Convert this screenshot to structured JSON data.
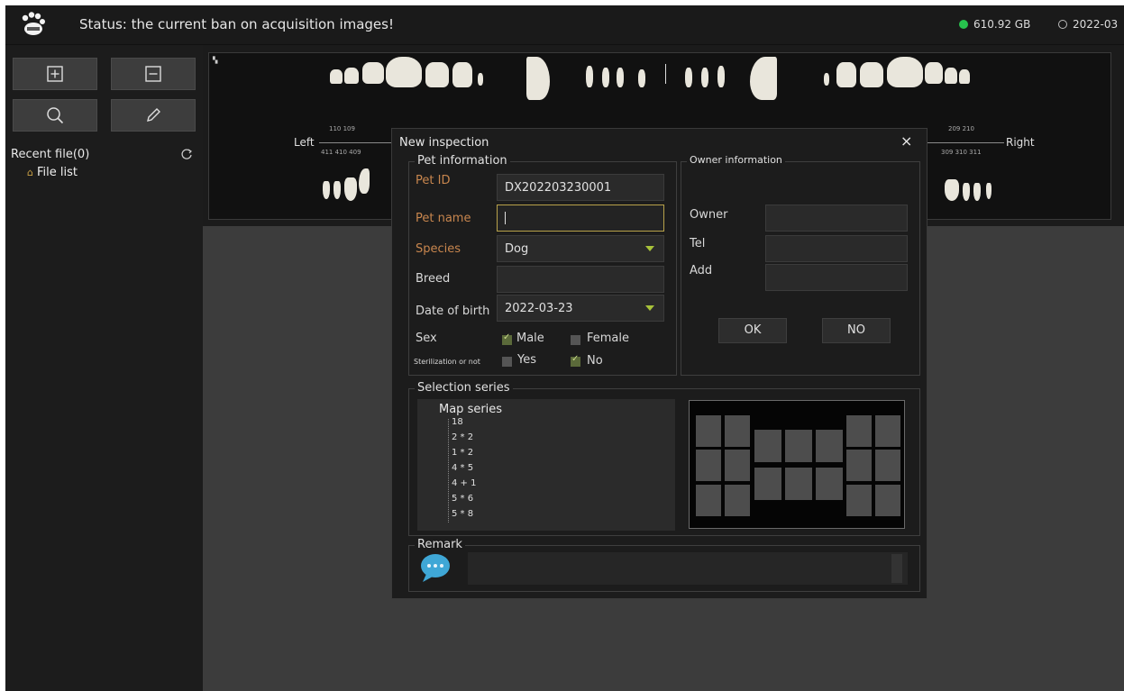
{
  "topbar": {
    "logo": "paw-logo",
    "status_text": "Status: the current ban on acquisition images!",
    "disk_free": "610.92 GB",
    "date": "2022-03",
    "disk_dot_color": "#27c34d"
  },
  "sidebar": {
    "tools": [
      {
        "icon": "zoom-in-icon"
      },
      {
        "icon": "zoom-out-icon"
      },
      {
        "icon": "search-icon"
      },
      {
        "icon": "edit-icon"
      }
    ],
    "recent_label": "Recent file(0)",
    "file_list_label": "File list"
  },
  "tooth_chart": {
    "left_label": "Left",
    "right_label": "Right",
    "upper_left_numbers": "110 109",
    "lower_left_numbers": "411 410 409",
    "upper_right_numbers": "209 210",
    "lower_right_numbers": "309 310 311"
  },
  "dialog": {
    "title": "New inspection",
    "close": "×",
    "pet_info": {
      "title": "Pet information",
      "pet_id_label": "Pet ID",
      "pet_id_value": "DX202203230001",
      "pet_name_label": "Pet name",
      "pet_name_value": "",
      "species_label": "Species",
      "species_value": "Dog",
      "breed_label": "Breed",
      "breed_value": "",
      "dob_label": "Date of birth",
      "dob_value": "2022-03-23",
      "sex_label": "Sex",
      "male_label": "Male",
      "female_label": "Female",
      "sterilization_label": "Sterilization or not",
      "yes_label": "Yes",
      "no_label": "No",
      "required_color": "#c8864e"
    },
    "owner_info": {
      "title": "Owner information",
      "owner_label": "Owner",
      "tel_label": "Tel",
      "add_label": "Add",
      "ok_label": "OK",
      "no_label": "NO"
    },
    "series": {
      "title": "Selection series",
      "root": "Map series",
      "items": [
        "18",
        "2 * 2",
        "1 * 2",
        "4 * 5",
        "4 + 1",
        "5 * 6",
        "5 * 8"
      ]
    },
    "remark": {
      "title": "Remark",
      "icon": "chat-bubble-icon"
    }
  }
}
